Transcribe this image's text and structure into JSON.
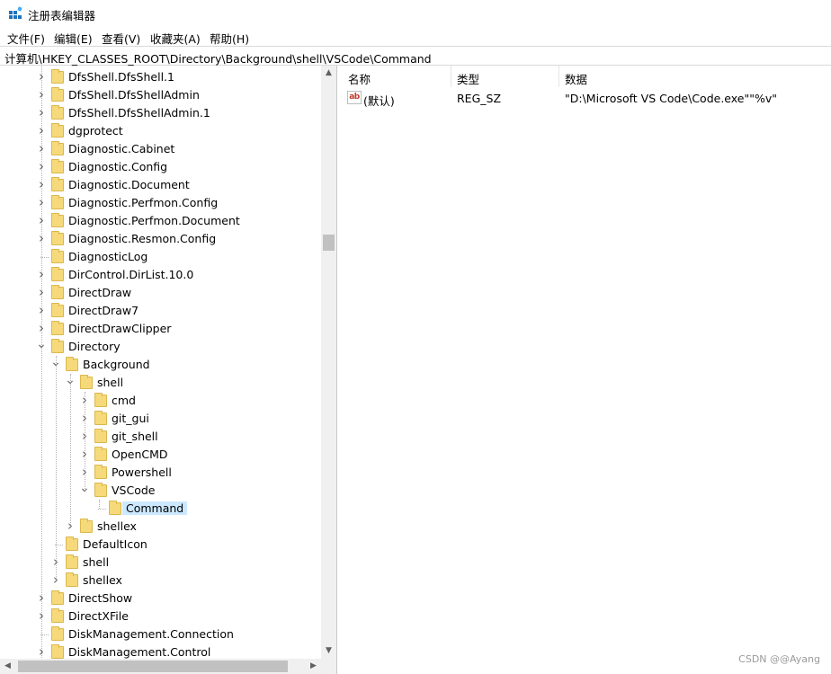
{
  "window": {
    "title": "注册表编辑器",
    "icon": "regedit-icon"
  },
  "menu": [
    "文件(F)",
    "编辑(E)",
    "查看(V)",
    "收藏夹(A)",
    "帮助(H)"
  ],
  "address": "计算机\\HKEY_CLASSES_ROOT\\Directory\\Background\\shell\\VSCode\\Command",
  "tree": [
    {
      "label": "DfsShell.DfsShell.1",
      "level": 0,
      "expander": "collapsed"
    },
    {
      "label": "DfsShell.DfsShellAdmin",
      "level": 0,
      "expander": "collapsed"
    },
    {
      "label": "DfsShell.DfsShellAdmin.1",
      "level": 0,
      "expander": "collapsed"
    },
    {
      "label": "dgprotect",
      "level": 0,
      "expander": "collapsed"
    },
    {
      "label": "Diagnostic.Cabinet",
      "level": 0,
      "expander": "collapsed"
    },
    {
      "label": "Diagnostic.Config",
      "level": 0,
      "expander": "collapsed"
    },
    {
      "label": "Diagnostic.Document",
      "level": 0,
      "expander": "collapsed"
    },
    {
      "label": "Diagnostic.Perfmon.Config",
      "level": 0,
      "expander": "collapsed"
    },
    {
      "label": "Diagnostic.Perfmon.Document",
      "level": 0,
      "expander": "collapsed"
    },
    {
      "label": "Diagnostic.Resmon.Config",
      "level": 0,
      "expander": "collapsed"
    },
    {
      "label": "DiagnosticLog",
      "level": 0,
      "expander": "none"
    },
    {
      "label": "DirControl.DirList.10.0",
      "level": 0,
      "expander": "collapsed"
    },
    {
      "label": "DirectDraw",
      "level": 0,
      "expander": "collapsed"
    },
    {
      "label": "DirectDraw7",
      "level": 0,
      "expander": "collapsed"
    },
    {
      "label": "DirectDrawClipper",
      "level": 0,
      "expander": "collapsed"
    },
    {
      "label": "Directory",
      "level": 0,
      "expander": "expanded"
    },
    {
      "label": "Background",
      "level": 1,
      "expander": "expanded"
    },
    {
      "label": "shell",
      "level": 2,
      "expander": "expanded"
    },
    {
      "label": "cmd",
      "level": 3,
      "expander": "collapsed"
    },
    {
      "label": "git_gui",
      "level": 3,
      "expander": "collapsed"
    },
    {
      "label": "git_shell",
      "level": 3,
      "expander": "collapsed"
    },
    {
      "label": "OpenCMD",
      "level": 3,
      "expander": "collapsed"
    },
    {
      "label": "Powershell",
      "level": 3,
      "expander": "collapsed"
    },
    {
      "label": "VSCode",
      "level": 3,
      "expander": "expanded"
    },
    {
      "label": "Command",
      "level": 4,
      "expander": "none",
      "selected": true
    },
    {
      "label": "shellex",
      "level": 2,
      "expander": "collapsed"
    },
    {
      "label": "DefaultIcon",
      "level": 1,
      "expander": "none"
    },
    {
      "label": "shell",
      "level": 1,
      "expander": "collapsed"
    },
    {
      "label": "shellex",
      "level": 1,
      "expander": "collapsed"
    },
    {
      "label": "DirectShow",
      "level": 0,
      "expander": "collapsed"
    },
    {
      "label": "DirectXFile",
      "level": 0,
      "expander": "collapsed"
    },
    {
      "label": "DiskManagement.Connection",
      "level": 0,
      "expander": "none"
    },
    {
      "label": "DiskManagement.Control",
      "level": 0,
      "expander": "collapsed"
    }
  ],
  "columns": {
    "name": "名称",
    "type": "类型",
    "data": "数据"
  },
  "values": [
    {
      "icon": "string-value-icon",
      "icon_text": "ab",
      "name": "(默认)",
      "type": "REG_SZ",
      "data": "\"D:\\Microsoft VS Code\\Code.exe\"\"%v\""
    }
  ],
  "watermark": "CSDN @@Ayang",
  "colors": {
    "selection": "#cce8ff",
    "folder": "#f6d97a"
  }
}
